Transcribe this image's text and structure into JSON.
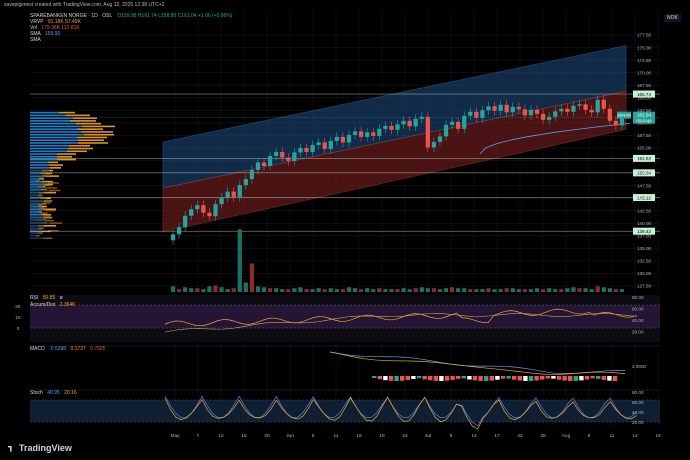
{
  "caption": "saveplgimest created with TradingView.com, Aug 12, 2025 12:38 UTC+2",
  "currency": "NOK",
  "legend": {
    "symbol": "SPAREBANKEN NORGE · 1D · OSL",
    "ohlc": "O159.98 H161.74 L158.80 C161.04 +1.06 (+0.66%)",
    "vrvp_label": "VRVP",
    "vrvp_values": "91.18K 57.49K",
    "vol_label": "Vol",
    "vol_values": "179.38K 112.81K",
    "sma1_label": "SMA",
    "sma1_value": "159.90",
    "sma2_label": "SMA"
  },
  "brand": "TradingView",
  "colors": {
    "up": "#26a69a",
    "down": "#ef5350",
    "channel_upper": "#1e4e82",
    "channel_lower": "#7a2020",
    "vp_up": "#2196f3",
    "vp_down": "#f5a623",
    "sma": "#5b9cf6"
  },
  "price_axis": {
    "ticks": [
      "177.50",
      "175.00",
      "172.50",
      "170.00",
      "167.50",
      "165.00",
      "162.50",
      "160.00",
      "157.50",
      "155.00",
      "152.50",
      "150.00",
      "147.50",
      "145.00",
      "142.50",
      "140.00",
      "137.50",
      "135.00",
      "132.50",
      "130.00",
      "127.50"
    ]
  },
  "levels": [
    {
      "value": "165.74",
      "price": 165.74
    },
    {
      "value": "152.92",
      "price": 152.92
    },
    {
      "value": "150.04",
      "price": 150.04
    },
    {
      "value": "145.12",
      "price": 145.12
    },
    {
      "value": "138.42",
      "price": 138.42
    }
  ],
  "last_price": {
    "label": "SBNOR",
    "value": "161.04",
    "countdown": "05:11:46",
    "price": 161.04
  },
  "rsi": {
    "label": "RSI",
    "v1": "50.85",
    "v2": "ø",
    "ticks": [
      "80.00",
      "60.00",
      "40.00",
      "20.00"
    ]
  },
  "ad": {
    "label": "Accum/Dist",
    "value": "2.364K",
    "ticks": [
      "2K",
      "1K",
      "0"
    ]
  },
  "macd": {
    "label": "MACD",
    "v1": "-0.5298",
    "v2": "0.1727",
    "v3": "0.7025",
    "ticks": [
      "2.0000"
    ]
  },
  "stoch": {
    "label": "Stoch",
    "v1": "40.95",
    "v2": "20.16",
    "ticks": [
      "80.00",
      "60.00",
      "40.00",
      "20.00"
    ]
  },
  "x_axis": {
    "labels": [
      "May",
      "7",
      "12",
      "15",
      "20",
      "Jun",
      "6",
      "11",
      "16",
      "19",
      "24",
      "Jul",
      "9",
      "14",
      "17",
      "22",
      "25",
      "Aug",
      "6",
      "11",
      "14",
      "19"
    ]
  },
  "chart_data": {
    "type": "candlestick",
    "closes": [
      137.8,
      139.2,
      141.5,
      142.8,
      143.6,
      142.1,
      141.4,
      143.8,
      145.1,
      146.3,
      145.2,
      147.6,
      148.8,
      150.6,
      152.1,
      151.4,
      153.4,
      154.2,
      153.1,
      152.4,
      154.1,
      155.0,
      154.2,
      155.6,
      156.1,
      154.8,
      156.4,
      157.2,
      156.1,
      157.6,
      158.3,
      157.2,
      158.1,
      157.4,
      158.8,
      159.4,
      158.6,
      159.7,
      160.4,
      159.3,
      160.8,
      161.2,
      155.1,
      156.2,
      157.3,
      159.6,
      160.2,
      158.8,
      161.4,
      162.2,
      161.0,
      162.5,
      163.3,
      162.4,
      163.6,
      162.1,
      163.2,
      162.7,
      161.5,
      162.6,
      161.8,
      160.6,
      161.2,
      162.3,
      162.8,
      162.2,
      163.4,
      163.7,
      162.6,
      162.1,
      164.6,
      162.8,
      160.4,
      159.5,
      161.04
    ],
    "channel": {
      "upper_start": 156.2,
      "upper_end": 175.4,
      "mid_start": 147.0,
      "mid_end": 166.3,
      "lower_start": 138.3,
      "lower_end": 158.7
    }
  }
}
